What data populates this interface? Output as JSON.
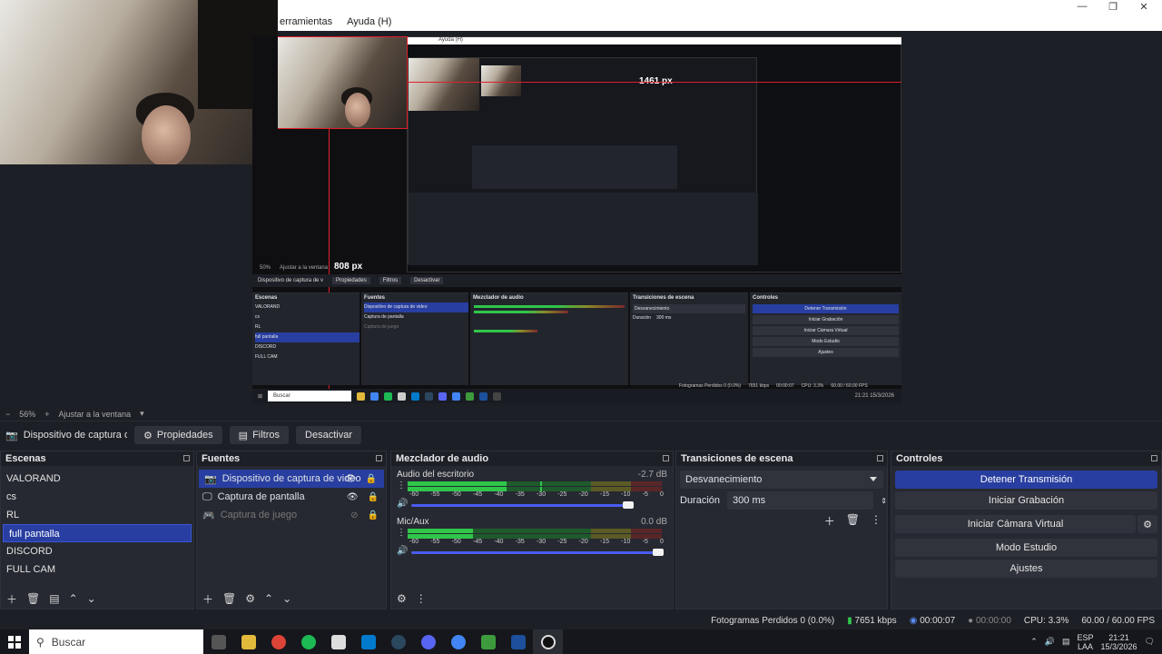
{
  "menu": {
    "tools": "erramientas",
    "help": "Ayuda (H)"
  },
  "preview": {
    "inner_menu_help": "Ayuda (H)",
    "label_width": "1461 px",
    "label_height": "808 px",
    "inner_zoom": "50%",
    "inner_fit": "Ajustar a la ventana",
    "inner_source": "Dispositivo de captura de v",
    "inner_props": "Propiedades",
    "inner_filters": "Filtros",
    "inner_deactivate": "Desactivar",
    "inner_docks": [
      "Escenas",
      "Fuentes",
      "Mezclador de audio",
      "Transiciones de escena",
      "Controles"
    ],
    "inner_scenes": [
      "VALORAND",
      "cs",
      "RL",
      "full pantalla",
      "DISCORD",
      "FULL CAM"
    ],
    "inner_sources": [
      "Dispositivo de captura de video",
      "Captura de pantalla",
      "Captura de juego"
    ],
    "inner_controls": [
      "Detener Transmisión",
      "Iniciar Grabación",
      "Iniciar Cámara Virtual",
      "Modo Estudio",
      "Ajustes"
    ],
    "inner_transition": "Desvanecimiento",
    "inner_duration_label": "Duración",
    "inner_duration": "300 ms",
    "inner_search": "Buscar",
    "inner_status": "Fotogramas Perdidos 0 (0.0%)",
    "inner_kbps": "7651 kbps",
    "inner_time": "00:00:07",
    "inner_cpu": "CPU: 3.3%",
    "inner_fps": "60.00 / 60.00 FPS",
    "inner_clock": "21:21",
    "inner_date": "15/3/2026"
  },
  "zoom": {
    "minus": "−",
    "value": "56%",
    "plus": "+",
    "fit": "Ajustar a la ventana"
  },
  "source_toolbar": {
    "source_name": "Dispositivo de captura de v",
    "properties": "Propiedades",
    "filters": "Filtros",
    "deactivate": "Desactivar"
  },
  "scenes": {
    "title": "Escenas",
    "items": [
      "VALORAND",
      "cs",
      "RL",
      "full pantalla",
      "DISCORD",
      "FULL CAM"
    ],
    "selected": "full pantalla"
  },
  "sources": {
    "title": "Fuentes",
    "items": [
      {
        "name": "Dispositivo de captura de video",
        "icon": "camera-icon"
      },
      {
        "name": "Captura de pantalla",
        "icon": "monitor-icon"
      },
      {
        "name": "Captura de juego",
        "icon": "gamepad-icon"
      }
    ]
  },
  "mixer": {
    "title": "Mezclador de audio",
    "channels": [
      {
        "name": "Audio del escritorio",
        "db": "-2.7 dB",
        "level": 0.39,
        "peak": 0.52,
        "volume": 0.88
      },
      {
        "name": "Mic/Aux",
        "db": "0.0 dB",
        "level": 0.25,
        "peak": 0.25,
        "volume": 1.0
      }
    ],
    "ticks": [
      "-60",
      "-55",
      "-50",
      "-45",
      "-40",
      "-35",
      "-30",
      "-25",
      "-20",
      "-15",
      "-10",
      "-5",
      "0"
    ]
  },
  "transitions": {
    "title": "Transiciones de escena",
    "selected": "Desvanecimiento",
    "duration_label": "Duración",
    "duration": "300 ms"
  },
  "controls": {
    "title": "Controles",
    "stop_stream": "Detener Transmisión",
    "start_recording": "Iniciar Grabación",
    "virtual_cam": "Iniciar Cámara Virtual",
    "studio_mode": "Modo Estudio",
    "settings": "Ajustes"
  },
  "status": {
    "dropped": "Fotogramas Perdidos 0 (0.0%)",
    "bitrate": "7651 kbps",
    "stream_time": "00:00:07",
    "rec_time": "00:00:00",
    "cpu": "CPU: 3.3%",
    "fps": "60.00 / 60.00 FPS"
  },
  "taskbar": {
    "search": "Buscar",
    "lang1": "ESP",
    "lang2": "LAA",
    "time": "21:21",
    "date": "15/3/2026"
  },
  "colors": {
    "accent": "#283ea0",
    "meter_green": "#2fc64a",
    "recording_red": "#e0202a"
  }
}
